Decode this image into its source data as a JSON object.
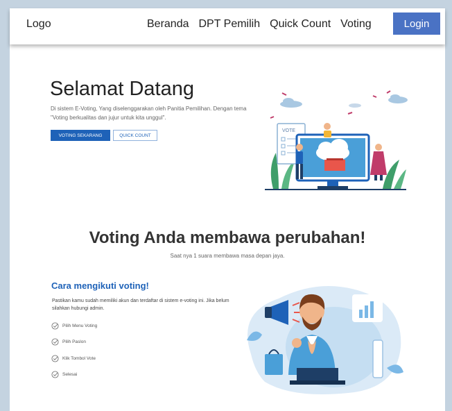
{
  "navbar": {
    "logo": "Logo",
    "links": [
      "Beranda",
      "DPT Pemilih",
      "Quick Count",
      "Voting"
    ],
    "login_label": "Login",
    "login_color": "#4a72c4"
  },
  "hero": {
    "title": "Selamat Datang",
    "description": "Di sistem E-Voting, Yang diselenggarakan oleh Panitia Pemilihan. Dengan tema \"Voting berkualitas dan jujur untuk kita unggul\".",
    "primary_button": "VOTING SEKARANG",
    "secondary_button": "QUICK COUNT",
    "illustration_text": "VOTE",
    "accent_color": "#1e62b8"
  },
  "tagline": {
    "title": "Voting Anda membawa perubahan!",
    "subtitle": "Saat nya 1 suara membawa masa depan jaya."
  },
  "steps": {
    "title": "Cara mengikuti voting!",
    "description": "Pastikan kamu sudah memiliki akun dan terdaftar di sistem e-voting ini. Jika belum silahkan hubungi admin.",
    "items": [
      "Pilih Menu Voting",
      "Pilih Paslon",
      "Klik Tombol Vote",
      "Selesai"
    ]
  }
}
